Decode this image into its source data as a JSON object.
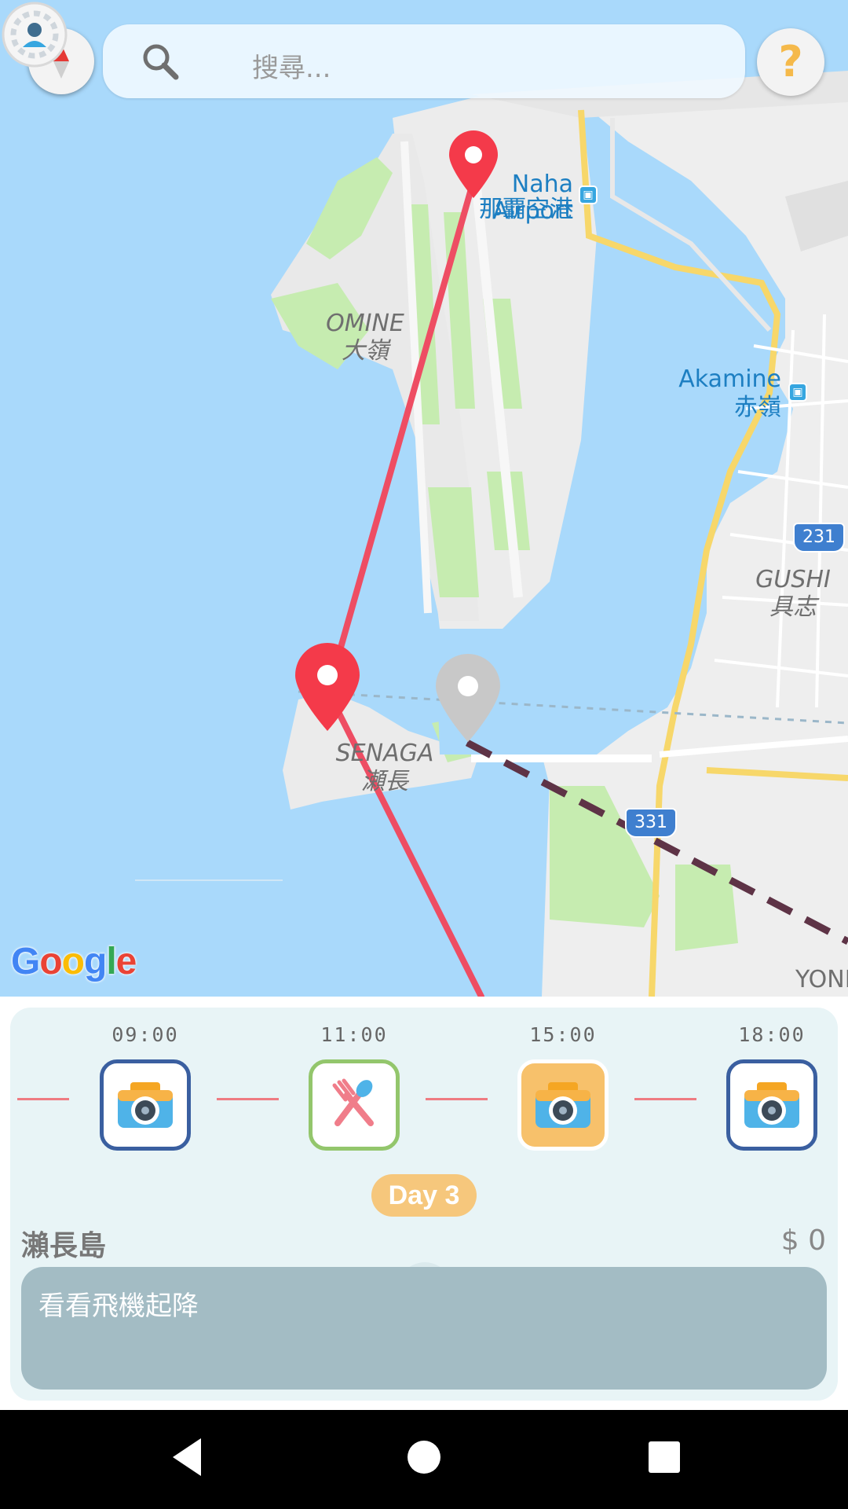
{
  "search": {
    "placeholder": "搜尋..."
  },
  "help": {
    "label": "?"
  },
  "map": {
    "labels": {
      "airport_en": "Naha Airport",
      "airport_jp": "那覇空港",
      "omine_en": "OMINE",
      "omine_jp": "大嶺",
      "akamine_en": "Akamine",
      "akamine_jp": "赤嶺",
      "gushi_en": "GUSHI",
      "gushi_jp": "具志",
      "senaga_en": "SENAGA",
      "senaga_jp": "瀬長",
      "yonaha": "YONI"
    },
    "route_shields": [
      "231",
      "331"
    ],
    "attribution": "Google",
    "colors": {
      "water": "#a9d9fb",
      "land": "#efefef",
      "green": "#c6ecb0",
      "route": "#ee4d63",
      "pin": "#f43a4a",
      "inactive_pin": "#c8c8c8",
      "dashed": "#5e3346"
    }
  },
  "timeline": {
    "items": [
      {
        "time": "09:00",
        "icon": "camera-icon",
        "border": "#3a5fa0",
        "fill": "#ffffff"
      },
      {
        "time": "11:00",
        "icon": "fork-spoon-icon",
        "border": "#93c66c",
        "fill": "#ffffff"
      },
      {
        "time": "15:00",
        "icon": "camera-icon",
        "border": "#ffffff",
        "fill": "#f7c16b"
      },
      {
        "time": "18:00",
        "icon": "camera-icon",
        "border": "#3a5fa0",
        "fill": "#ffffff"
      }
    ]
  },
  "day_badge": "Day 3",
  "place": {
    "name": "瀨長島",
    "cost": "$ 0"
  },
  "note": {
    "text": "看看飛機起降"
  }
}
